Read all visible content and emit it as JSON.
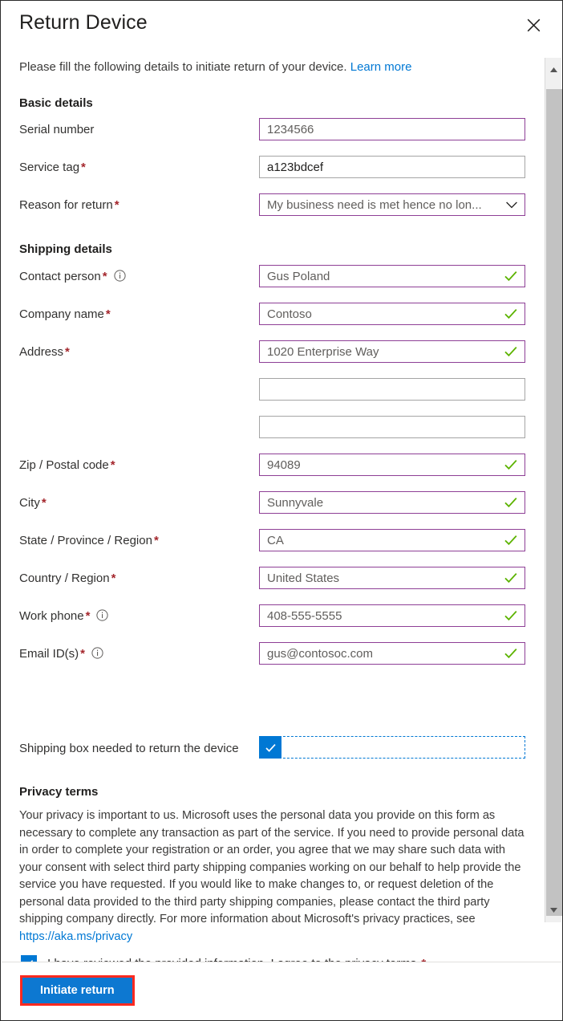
{
  "dialog": {
    "title": "Return Device",
    "close_icon": "close-icon",
    "subtitle_text": "Please fill the following details to initiate return of your device.",
    "subtitle_link": "Learn more"
  },
  "sections": {
    "basic_details_heading": "Basic details",
    "shipping_details_heading": "Shipping details",
    "privacy_heading": "Privacy terms"
  },
  "basic_fields": [
    {
      "label": "Serial number",
      "required": false,
      "info": false,
      "value": "1234566",
      "placeholder": "",
      "accent": true,
      "valid": false,
      "dropdown": false,
      "dark_text": false
    },
    {
      "label": "Service tag",
      "required": true,
      "info": false,
      "value": "a123bdcef",
      "placeholder": "",
      "accent": false,
      "valid": false,
      "dropdown": false,
      "dark_text": true
    },
    {
      "label": "Reason for return",
      "required": true,
      "info": false,
      "value": "My business need is met hence no lon...",
      "placeholder": "",
      "accent": true,
      "valid": false,
      "dropdown": true,
      "dark_text": false
    }
  ],
  "shipping_fields": [
    {
      "label": "Contact person",
      "required": true,
      "info": true,
      "value": "Gus Poland",
      "accent": true,
      "valid": true,
      "dropdown": false,
      "dark_text": false
    },
    {
      "label": "Company name",
      "required": true,
      "info": false,
      "value": "Contoso",
      "accent": true,
      "valid": true,
      "dropdown": false,
      "dark_text": false
    },
    {
      "label": "Address",
      "required": true,
      "info": false,
      "value": "1020 Enterprise Way",
      "accent": true,
      "valid": true,
      "dropdown": false,
      "dark_text": false
    },
    {
      "label": "",
      "required": false,
      "info": false,
      "value": "",
      "accent": false,
      "valid": false,
      "dropdown": false,
      "dark_text": false
    },
    {
      "label": "",
      "required": false,
      "info": false,
      "value": "",
      "accent": false,
      "valid": false,
      "dropdown": false,
      "dark_text": false
    },
    {
      "label": "Zip / Postal code",
      "required": true,
      "info": false,
      "value": "94089",
      "accent": true,
      "valid": true,
      "dropdown": false,
      "dark_text": false
    },
    {
      "label": "City",
      "required": true,
      "info": false,
      "value": "Sunnyvale",
      "accent": true,
      "valid": true,
      "dropdown": false,
      "dark_text": false
    },
    {
      "label": "State / Province / Region",
      "required": true,
      "info": false,
      "value": "CA",
      "accent": true,
      "valid": true,
      "dropdown": false,
      "dark_text": false
    },
    {
      "label": "Country / Region",
      "required": true,
      "info": false,
      "value": "United States",
      "accent": true,
      "valid": true,
      "dropdown": false,
      "dark_text": false
    },
    {
      "label": "Work phone",
      "required": true,
      "info": true,
      "value": "408-555-5555",
      "accent": true,
      "valid": true,
      "dropdown": false,
      "dark_text": false
    },
    {
      "label": "Email ID(s)",
      "required": true,
      "info": true,
      "value": "gus@contosoc.com",
      "accent": true,
      "valid": true,
      "dropdown": false,
      "dark_text": false
    }
  ],
  "shipping_box": {
    "label": "Shipping box needed to return the device",
    "checked": true
  },
  "privacy": {
    "paragraph": "Your privacy is important to us. Microsoft uses the personal data you provide on this form as necessary to complete any transaction as part of the service. If you need to provide personal data in order to complete your registration or an order, you agree that we may share such data with your consent with select third party shipping companies working on our behalf to help provide the service you have requested. If you would like to make changes to, or request deletion of the personal data provided to the third party shipping companies, please contact the third party shipping company directly. For more information about Microsoft's privacy practices, see ",
    "link_text": "https://aka.ms/privacy",
    "consent_label": "I have reviewed the provided information. I agree to the privacy terms.",
    "consent_required": "*",
    "consent_checked": true
  },
  "footer": {
    "submit_label": "Initiate return"
  },
  "colors": {
    "accent_border": "#8e3f96",
    "valid_check": "#5cb300",
    "required_star": "#a4262c",
    "link_blue": "#0078d4",
    "checkbox_blue": "#0078d4",
    "button_blue": "#0d78d1",
    "annotation_red": "#ff2a20",
    "neutral_border": "#a5a5a5",
    "scrollbar_thumb": "#c2c2c2"
  },
  "scrollbar": {
    "up_icon": "triangle-up-icon",
    "down_icon": "triangle-down-icon"
  }
}
